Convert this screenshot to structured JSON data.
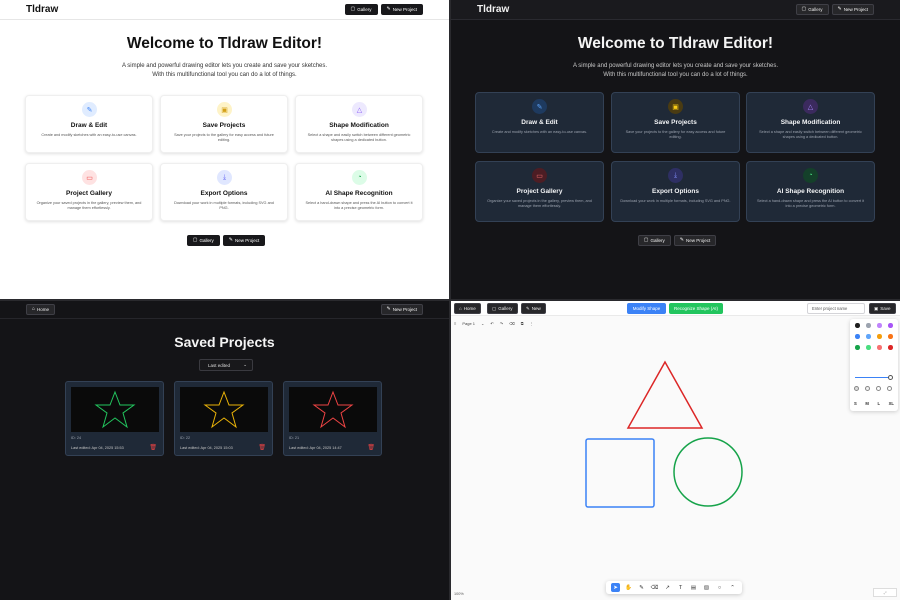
{
  "home_light": {
    "brand": "Tldraw",
    "nav": {
      "gallery": "Gallery",
      "new_project": "New Project"
    },
    "title": "Welcome to Tldraw Editor!",
    "subtitle_1": "A simple and powerful drawing editor lets you create and save your sketches.",
    "subtitle_2": "With this multifunctional tool you can do a lot of things.",
    "cards": [
      {
        "icon": "pencil-icon",
        "title": "Draw & Edit",
        "desc": "Create and modify sketches with an easy-to-use canvas."
      },
      {
        "icon": "save-icon",
        "title": "Save Projects",
        "desc": "Save your projects to the gallery for easy access and future editing."
      },
      {
        "icon": "shapes-icon",
        "title": "Shape Modification",
        "desc": "Select a shape and easily switch between different geometric shapes using a dedicated button."
      },
      {
        "icon": "gallery-icon",
        "title": "Project Gallery",
        "desc": "Organize your saved projects in the gallery, preview them, and manage them effortlessly."
      },
      {
        "icon": "download-icon",
        "title": "Export Options",
        "desc": "Download your work in multiple formats, including SVG and PNG."
      },
      {
        "icon": "ai-icon",
        "title": "AI Shape Recognition",
        "desc": "Select a hand-drawn shape and press the AI button to convert it into a precise geometric form."
      }
    ],
    "bottom_gallery": "Gallery",
    "bottom_new_project": "New Project"
  },
  "home_dark": {
    "brand": "Tldraw",
    "nav": {
      "gallery": "Gallery",
      "new_project": "New Project"
    },
    "title": "Welcome to Tldraw Editor!",
    "subtitle_1": "A simple and powerful drawing editor lets you create and save your sketches.",
    "subtitle_2": "With this multifunctional tool you can do a lot of things.",
    "cards": [
      {
        "icon": "pencil-icon",
        "title": "Draw & Edit",
        "desc": "Create and modify sketches with an easy-to-use canvas."
      },
      {
        "icon": "save-icon",
        "title": "Save Projects",
        "desc": "Save your projects to the gallery for easy access and future editing."
      },
      {
        "icon": "shapes-icon",
        "title": "Shape Modification",
        "desc": "Select a shape and easily switch between different geometric shapes using a dedicated button."
      },
      {
        "icon": "gallery-icon",
        "title": "Project Gallery",
        "desc": "Organize your saved projects in the gallery, preview them, and manage them effortlessly."
      },
      {
        "icon": "download-icon",
        "title": "Export Options",
        "desc": "Download your work in multiple formats, including SVG and PNG."
      },
      {
        "icon": "ai-icon",
        "title": "AI Shape Recognition",
        "desc": "Select a hand-drawn shape and press the AI button to convert it into a precise geometric form."
      }
    ],
    "bottom_gallery": "Gallery",
    "bottom_new_project": "New Project"
  },
  "saved": {
    "home": "Home",
    "new_project": "New Project",
    "title": "Saved Projects",
    "sort_value": "Last edited",
    "projects": [
      {
        "id": "ID: 24",
        "last_edited": "Last edited: Apr 04, 2025 15:53",
        "star_color": "#22c55e"
      },
      {
        "id": "ID: 22",
        "last_edited": "Last edited: Apr 04, 2025 15:03",
        "star_color": "#eab308"
      },
      {
        "id": "ID: 21",
        "last_edited": "Last edited: Apr 04, 2025 14:47",
        "star_color": "#ef4444"
      }
    ]
  },
  "editor": {
    "home": "Home",
    "gallery": "Gallery",
    "new": "New",
    "modify_shape": "Modify Shape",
    "recognize_shape": "Recognize Shape (AI)",
    "project_name_placeholder": "Enter project name",
    "save": "Save",
    "page": "Page 1",
    "zoom": "100%",
    "sizes": [
      "S",
      "M",
      "L",
      "XL"
    ],
    "colors": {
      "modify": "#3b82f6",
      "recognize": "#22c55e",
      "triangle": "#dc2626",
      "square": "#3b82f6",
      "circle": "#16a34a"
    }
  }
}
